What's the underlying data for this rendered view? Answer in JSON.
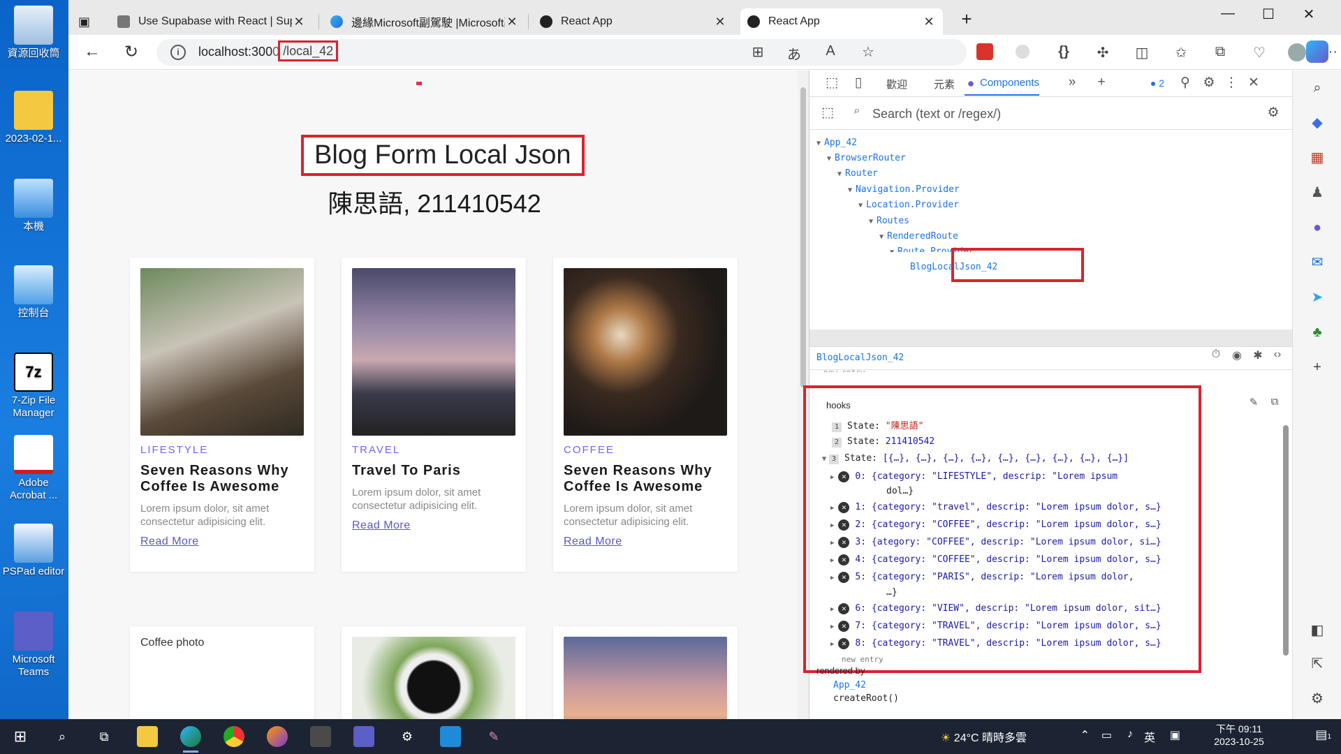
{
  "desktop": {
    "icons": [
      {
        "label": "資源回收筒",
        "icon": "recycle-bin-icon"
      },
      {
        "label": "2023-02-1...",
        "icon": "folder-icon"
      },
      {
        "label": "本機",
        "icon": "computer-icon"
      },
      {
        "label": "控制台",
        "icon": "control-panel-icon"
      },
      {
        "label": "7-Zip File Manager",
        "icon": "7zip-icon"
      },
      {
        "label": "Adobe Acrobat ...",
        "icon": "acrobat-icon"
      },
      {
        "label": "PSPad editor",
        "icon": "pspad-icon"
      },
      {
        "label": "Microsoft Teams",
        "icon": "teams-icon"
      }
    ],
    "sevenzip_glyph": "7z"
  },
  "browser": {
    "tabs": [
      {
        "title": "Use Supabase with React | Supab",
        "close": "✕"
      },
      {
        "title": "邊緣Microsoft副駕駛 |Microsoft副",
        "close": "✕"
      },
      {
        "title": "React App",
        "close": "✕"
      },
      {
        "title": "React App",
        "close": "✕"
      }
    ],
    "new_tab": "+",
    "window_controls": {
      "minimize": "—",
      "maximize": "☐",
      "close": "✕"
    },
    "nav": {
      "back": "←",
      "reload": "↻"
    },
    "address": {
      "info": "i",
      "host": "localhost:300",
      "host_hidden": "0",
      "path": "/local_42"
    },
    "toolbar_glyphs": {
      "apps": "⊞",
      "translate": "あ",
      "read": "A",
      "favorite": "☆",
      "braces": "{}",
      "more": "···"
    }
  },
  "page": {
    "title": "Blog Form Local Json",
    "subtitle": "陳思語, 211410542",
    "cards": [
      {
        "category": "LIFESTYLE",
        "title": "Seven Reasons Why Coffee Is Awesome",
        "desc": "Lorem ipsum dolor, sit amet consectetur adipisicing elit.",
        "link": "Read More"
      },
      {
        "category": "TRAVEL",
        "title": "Travel To Paris",
        "desc": "Lorem ipsum dolor, sit amet consectetur adipisicing elit.",
        "link": "Read More"
      },
      {
        "category": "COFFEE",
        "title": "Seven Reasons Why Coffee Is Awesome",
        "desc": "Lorem ipsum dolor, sit amet consectetur adipisicing elit.",
        "link": "Read More"
      }
    ],
    "broken_image_alt": "Coffee photo"
  },
  "devtools": {
    "tabs": [
      "歡迎",
      "元素",
      "Components"
    ],
    "more_tabs": "»",
    "add_tab": "+",
    "issues_count": "2",
    "search_placeholder": "Search (text or /regex/)",
    "tree": [
      {
        "label": "App_42",
        "depth": 0
      },
      {
        "label": "BrowserRouter",
        "depth": 1
      },
      {
        "label": "Router",
        "depth": 2
      },
      {
        "label": "Navigation.Provider",
        "depth": 3
      },
      {
        "label": "Location.Provider",
        "depth": 4
      },
      {
        "label": "Routes",
        "depth": 5
      },
      {
        "label": "RenderedRoute",
        "depth": 6
      },
      {
        "label": "Route.Provider",
        "depth": 7
      },
      {
        "label": "BlogLocalJson_42",
        "depth": 8
      }
    ],
    "selected": "BlogLocalJson_42",
    "clipped_text": "new entry",
    "hooks_label": "hooks",
    "states": [
      {
        "num": "1",
        "label": "State:",
        "value": "\"陳思語\""
      },
      {
        "num": "2",
        "label": "State:",
        "value": "211410542"
      },
      {
        "num": "3",
        "label": "State:",
        "value": "[{…}, {…}, {…}, {…}, {…}, {…}, {…}, {…}, {…}]"
      }
    ],
    "entries": [
      {
        "line1": "0: {category: \"LIFESTYLE\", descrip: \"Lorem ipsum",
        "line2": "dol…}"
      },
      {
        "line1": "1: {category: \"travel\", descrip: \"Lorem ipsum dolor, s…}",
        "line2": ""
      },
      {
        "line1": "2: {category: \"COFFEE\", descrip: \"Lorem ipsum dolor, s…}",
        "line2": ""
      },
      {
        "line1": "3: {ategory: \"COFFEE\", descrip: \"Lorem ipsum dolor, si…}",
        "line2": ""
      },
      {
        "line1": "4: {category: \"COFFEE\", descrip: \"Lorem ipsum dolor, s…}",
        "line2": ""
      },
      {
        "line1": "5: {category: \"PARIS\", descrip: \"Lorem ipsum dolor,",
        "line2": "…}"
      },
      {
        "line1": "6: {category: \"VIEW\", descrip: \"Lorem ipsum dolor, sit…}",
        "line2": ""
      },
      {
        "line1": "7: {category: \"TRAVEL\", descrip: \"Lorem ipsum dolor, s…}",
        "line2": ""
      },
      {
        "line1": "8: {category: \"TRAVEL\", descrip: \"Lorem ipsum dolor, s…}",
        "line2": ""
      }
    ],
    "new_entry": "new entry",
    "rendered_by_label": "rendered by",
    "rendered_by": [
      "App_42",
      "createRoot()"
    ]
  },
  "taskbar": {
    "weather": "24°C 晴時多雲",
    "ime": "英",
    "time": "下午 09:11",
    "date": "2023-10-25",
    "notification_count": "1"
  }
}
